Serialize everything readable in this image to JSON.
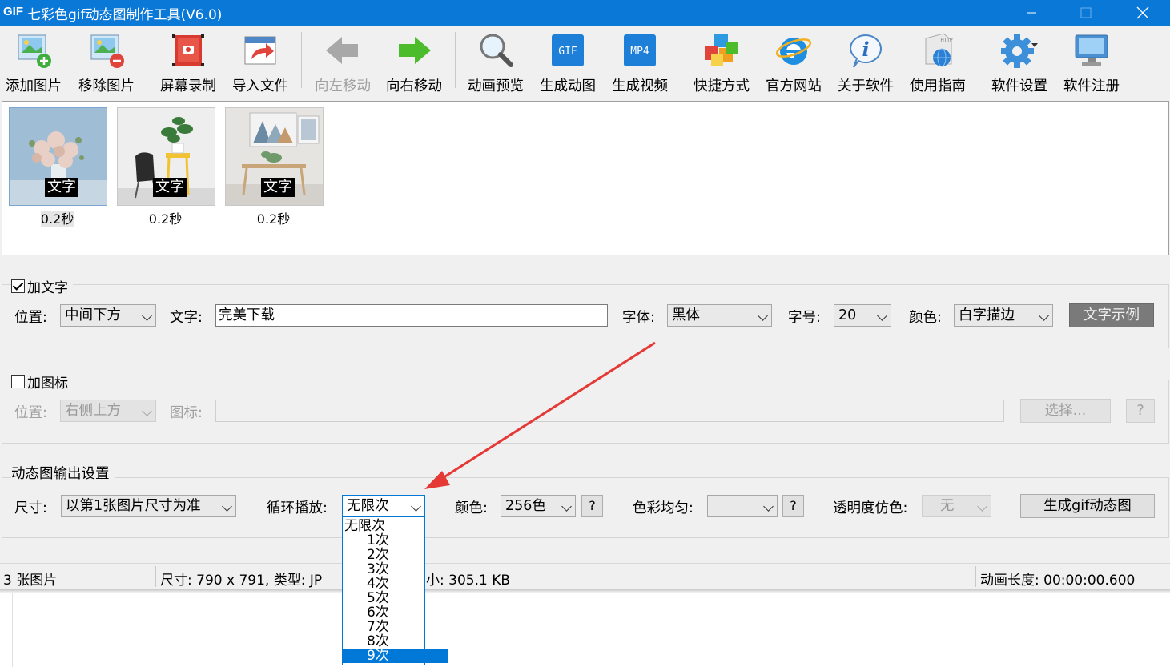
{
  "titlebar": {
    "logo": "GIF",
    "title": "七彩色gif动态图制作工具(V6.0)"
  },
  "toolbar": {
    "buttons": [
      {
        "label": "添加图片",
        "icon": "add-image-icon"
      },
      {
        "label": "移除图片",
        "icon": "remove-image-icon"
      },
      {
        "label": "屏幕录制",
        "icon": "screen-record-icon"
      },
      {
        "label": "导入文件",
        "icon": "import-file-icon"
      },
      {
        "label": "向左移动",
        "icon": "arrow-left-icon",
        "disabled": true
      },
      {
        "label": "向右移动",
        "icon": "arrow-right-icon"
      },
      {
        "label": "动画预览",
        "icon": "magnifier-icon"
      },
      {
        "label": "生成动图",
        "icon": "gif-icon",
        "badge": "GIF"
      },
      {
        "label": "生成视频",
        "icon": "mp4-icon",
        "badge": "MP4"
      },
      {
        "label": "快捷方式",
        "icon": "cubes-icon"
      },
      {
        "label": "官方网站",
        "icon": "ie-browser-icon"
      },
      {
        "label": "关于软件",
        "icon": "info-icon"
      },
      {
        "label": "使用指南",
        "icon": "http-globe-icon",
        "badge": "HTTP"
      },
      {
        "label": "软件设置",
        "icon": "gear-icon"
      },
      {
        "label": "软件注册",
        "icon": "monitor-icon"
      }
    ]
  },
  "images": [
    {
      "overlay": "文字",
      "duration": "0.2秒"
    },
    {
      "overlay": "文字",
      "duration": "0.2秒"
    },
    {
      "overlay": "文字",
      "duration": "0.2秒"
    }
  ],
  "text_group": {
    "checkbox_label": "加文字",
    "checked": true,
    "position_label": "位置:",
    "position_value": "中间下方",
    "text_label": "文字:",
    "text_value": "完美下载",
    "font_label": "字体:",
    "font_value": "黑体",
    "size_label": "字号:",
    "size_value": "20",
    "color_label": "颜色:",
    "color_value": "白字描边",
    "example_button": "文字示例"
  },
  "icon_group": {
    "checkbox_label": "加图标",
    "checked": false,
    "position_label": "位置:",
    "position_value": "右侧上方",
    "icon_label": "图标:",
    "icon_value": "",
    "select_button": "选择...",
    "help_button": "?"
  },
  "output_group": {
    "title": "动态图输出设置",
    "size_label": "尺寸:",
    "size_value": "以第1张图片尺寸为准",
    "loop_label": "循环播放:",
    "loop_value": "无限次",
    "color_label": "颜色:",
    "color_value": "256色",
    "color_help": "?",
    "balance_label": "色彩均匀:",
    "balance_value": "",
    "balance_help": "?",
    "transparency_label": "透明度仿色:",
    "transparency_value": "无",
    "generate_button": "生成gif动态图"
  },
  "loop_dropdown": {
    "options": [
      "无限次",
      "1次",
      "2次",
      "3次",
      "4次",
      "5次",
      "6次",
      "7次",
      "8次",
      "9次"
    ],
    "selected_index": 9
  },
  "status": {
    "count": "3 张图片",
    "info_left": "尺寸: 790 x 791, 类型: JP",
    "info_right": "小: 305.1 KB",
    "duration": "动画长度: 00:00:00.600"
  },
  "colors": {
    "titlebar": "#0a78d7",
    "selection": "#0078d7",
    "annotation_arrow": "#e53935"
  }
}
